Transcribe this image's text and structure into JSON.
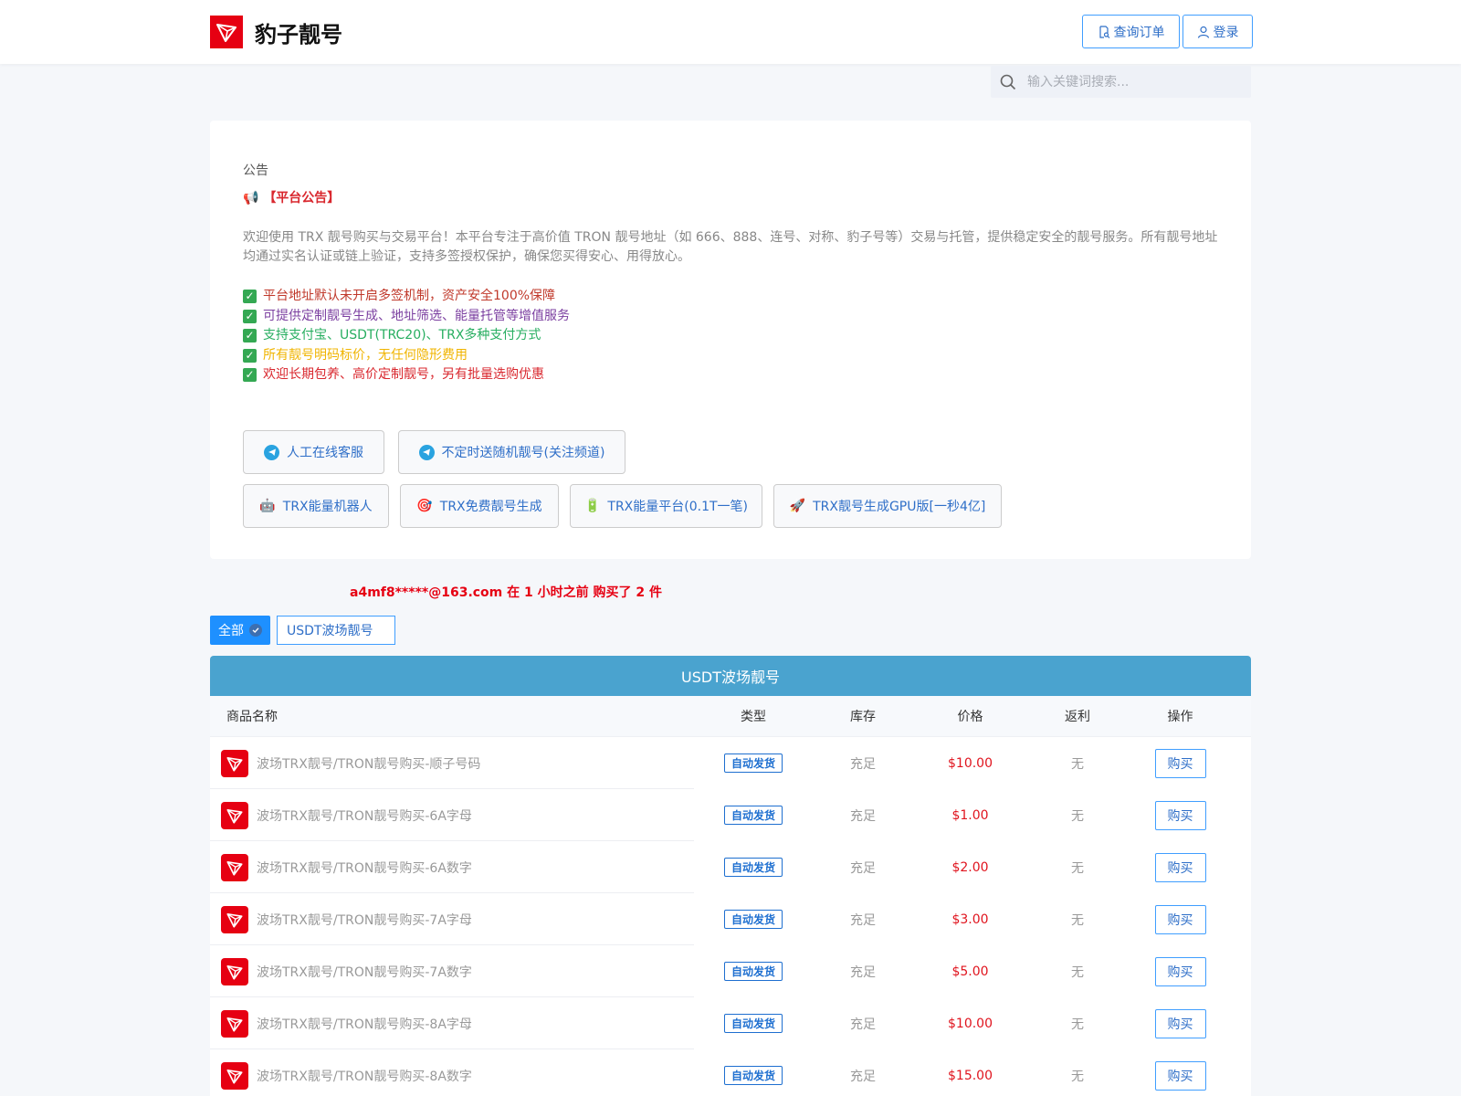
{
  "brand": {
    "name": "豹子靓号",
    "logo_icon": "tron-logo-icon",
    "accent": "#e60012"
  },
  "header": {
    "order_label": "查询订单",
    "login_label": "登录"
  },
  "search": {
    "placeholder": "输入关键词搜索..."
  },
  "notice": {
    "label": "公告",
    "title": "【平台公告】",
    "body": "欢迎使用 TRX 靓号购买与交易平台！本平台专注于高价值 TRON 靓号地址（如 666、888、连号、对称、豹子号等）交易与托管，提供稳定安全的靓号服务。所有靓号地址均通过实名认证或链上验证，支持多签授权保护，确保您买得安心、用得放心。",
    "items": [
      {
        "text": "平台地址默认未开启多签机制，资产安全100%保障",
        "color": "#c0392b"
      },
      {
        "text": "可提供定制靓号生成、地址筛选、能量托管等增值服务",
        "color": "#7b3fa0"
      },
      {
        "text": "支持支付宝、USDT(TRC20)、TRX多种支付方式",
        "color": "#27ae60"
      },
      {
        "text": "所有靓号明码标价，无任何隐形费用",
        "color": "#f0b400"
      },
      {
        "text": "欢迎长期包养、高价定制靓号，另有批量选购优惠",
        "color": "#d9272e"
      }
    ],
    "buttons": [
      {
        "label": "人工在线客服",
        "icon": "telegram-icon"
      },
      {
        "label": "不定时送随机靓号(关注频道)",
        "icon": "telegram-icon"
      },
      {
        "label": "TRX能量机器人",
        "icon": "robot-icon",
        "glyph": "🤖"
      },
      {
        "label": "TRX免费靓号生成",
        "icon": "target-icon",
        "glyph": "🎯"
      },
      {
        "label": "TRX能量平台(0.1T一笔)",
        "icon": "battery-icon",
        "glyph": "🔋"
      },
      {
        "label": "TRX靓号生成GPU版[一秒4亿]",
        "icon": "rocket-icon",
        "glyph": "🚀"
      }
    ]
  },
  "ticker": {
    "text": "a4mf8*****@163.com 在 1 小时之前 购买了 2 件"
  },
  "tabs": {
    "all_label": "全部",
    "usdt_label": "USDT波场靓号"
  },
  "table": {
    "title": "USDT波场靓号",
    "columns": [
      "商品名称",
      "类型",
      "库存",
      "价格",
      "返利",
      "操作"
    ],
    "rows": [
      {
        "name": "波场TRX靓号/TRON靓号购买-顺子号码",
        "type": "自动发货",
        "stock": "充足",
        "price": "$10.00",
        "rebate": "无",
        "action": "购买"
      },
      {
        "name": "波场TRX靓号/TRON靓号购买-6A字母",
        "type": "自动发货",
        "stock": "充足",
        "price": "$1.00",
        "rebate": "无",
        "action": "购买"
      },
      {
        "name": "波场TRX靓号/TRON靓号购买-6A数字",
        "type": "自动发货",
        "stock": "充足",
        "price": "$2.00",
        "rebate": "无",
        "action": "购买"
      },
      {
        "name": "波场TRX靓号/TRON靓号购买-7A字母",
        "type": "自动发货",
        "stock": "充足",
        "price": "$3.00",
        "rebate": "无",
        "action": "购买"
      },
      {
        "name": "波场TRX靓号/TRON靓号购买-7A数字",
        "type": "自动发货",
        "stock": "充足",
        "price": "$5.00",
        "rebate": "无",
        "action": "购买"
      },
      {
        "name": "波场TRX靓号/TRON靓号购买-8A字母",
        "type": "自动发货",
        "stock": "充足",
        "price": "$10.00",
        "rebate": "无",
        "action": "购买"
      },
      {
        "name": "波场TRX靓号/TRON靓号购买-8A数字",
        "type": "自动发货",
        "stock": "充足",
        "price": "$15.00",
        "rebate": "无",
        "action": "购买"
      }
    ]
  }
}
